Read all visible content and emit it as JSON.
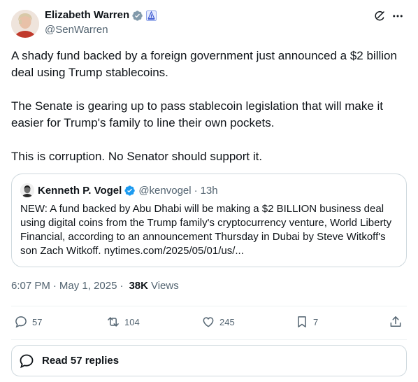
{
  "author": {
    "name": "Elizabeth Warren",
    "handle": "@SenWarren"
  },
  "tweet": {
    "paragraphs": [
      "A shady fund backed by a foreign government just announced a $2 billion deal using Trump stablecoins.",
      "The Senate is gearing up to pass stablecoin legislation that will make it easier for Trump's family to line their own pockets.",
      "This is corruption. No Senator should support it."
    ]
  },
  "quote": {
    "name": "Kenneth P. Vogel",
    "handle": "@kenvogel",
    "dot": "·",
    "time": "13h",
    "text": "NEW: A fund backed by Abu Dhabi will be making a $2 BILLION business deal using digital coins from the Trump family's cryptocurrency venture, World Liberty Financial, according to an announcement Thursday in Dubai by Steve Witkoff's son Zach Witkoff. nytimes.com/2025/05/01/us/..."
  },
  "meta": {
    "time": "6:07 PM",
    "date": "May 1, 2025",
    "sep": "·",
    "views_count": "38K",
    "views_label": "Views"
  },
  "actions": {
    "replies": "57",
    "reposts": "104",
    "likes": "245",
    "bookmarks": "7"
  },
  "read_replies": {
    "label": "Read 57 replies"
  },
  "colors": {
    "text": "#0f1419",
    "secondary": "#536471",
    "verified": "#1d9bf0",
    "border": "#cfd9de"
  }
}
